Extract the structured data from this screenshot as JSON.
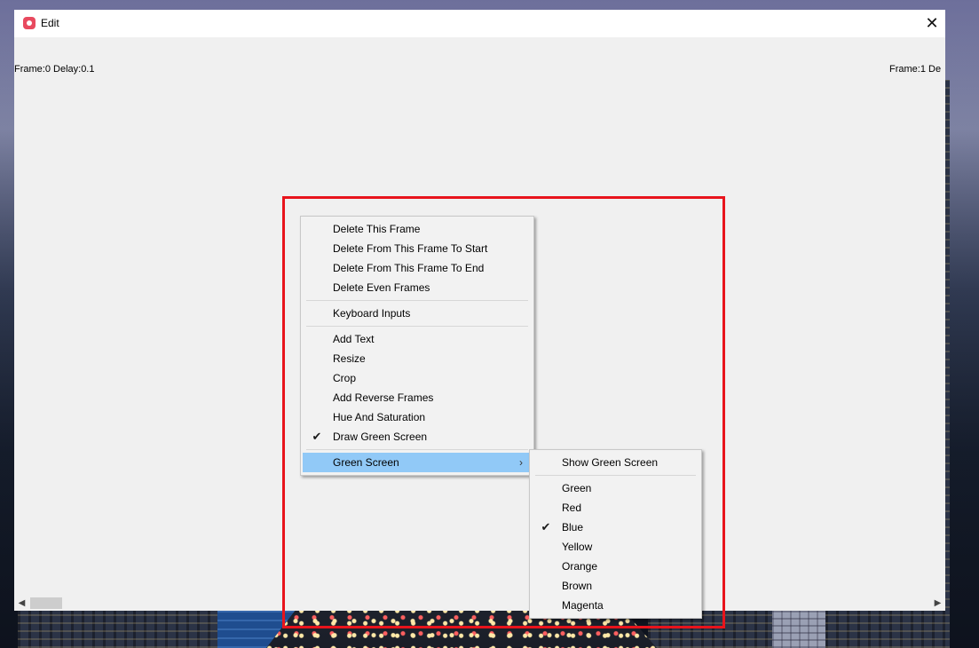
{
  "window": {
    "title": "Edit",
    "close_icon": "close-icon",
    "app_icon": "camera-icon"
  },
  "frames": {
    "left_label": "Frame:0  Delay:0.1",
    "right_label": "Frame:1  De"
  },
  "context_menu": {
    "items": [
      {
        "label": "Delete This Frame"
      },
      {
        "label": "Delete From This Frame To Start"
      },
      {
        "label": "Delete From This Frame To End"
      },
      {
        "label": "Delete Even Frames"
      },
      {
        "label": "Keyboard Inputs"
      },
      {
        "label": "Add Text"
      },
      {
        "label": "Resize"
      },
      {
        "label": "Crop"
      },
      {
        "label": "Add Reverse Frames"
      },
      {
        "label": "Hue And Saturation"
      },
      {
        "label": "Draw Green Screen",
        "checked": true
      },
      {
        "label": "Green Screen",
        "submenu": true,
        "highlighted": true
      }
    ]
  },
  "submenu": {
    "items": [
      {
        "label": "Show Green Screen"
      },
      {
        "label": "Green"
      },
      {
        "label": "Red"
      },
      {
        "label": "Blue",
        "checked": true
      },
      {
        "label": "Yellow"
      },
      {
        "label": "Orange"
      },
      {
        "label": "Brown"
      },
      {
        "label": "Magenta"
      }
    ]
  },
  "colors": {
    "highlight_border": "#e8141c",
    "menu_hover": "#91c9f7",
    "app_icon": "#e84a5f"
  }
}
